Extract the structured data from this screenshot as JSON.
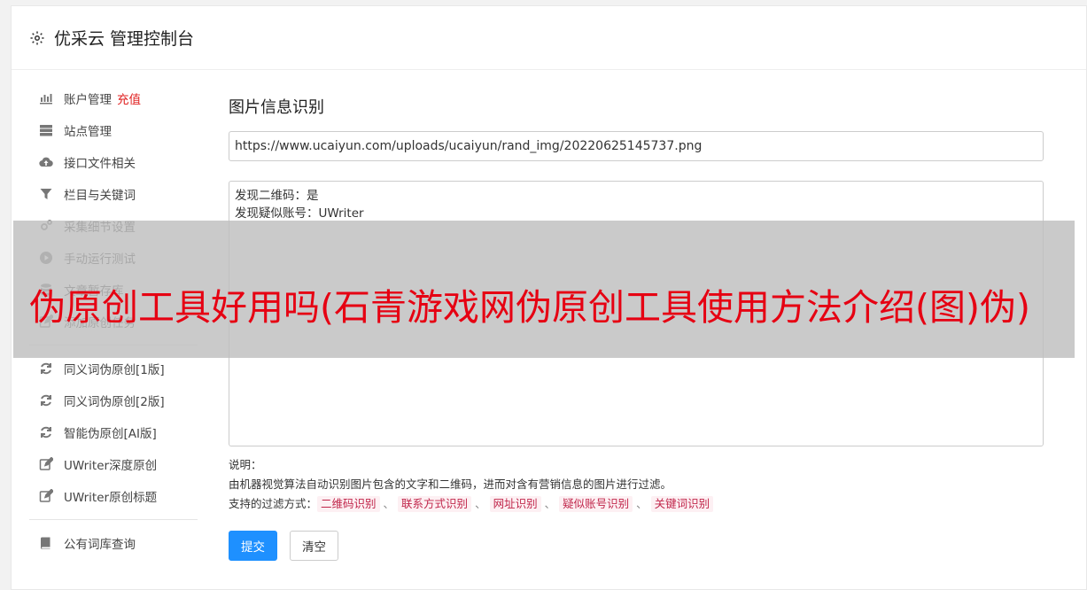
{
  "header": {
    "title": "优采云 管理控制台"
  },
  "sidebar": {
    "group1": [
      {
        "label": "账户管理",
        "icon": "bar-chart-icon",
        "badge": "充值"
      },
      {
        "label": "站点管理",
        "icon": "server-icon"
      },
      {
        "label": "接口文件相关",
        "icon": "cloud-upload-icon"
      },
      {
        "label": "栏目与关键词",
        "icon": "filter-icon"
      },
      {
        "label": "采集细节设置",
        "icon": "gears-icon"
      },
      {
        "label": "手动运行测试",
        "icon": "play-circle-icon"
      },
      {
        "label": "文章暂存库",
        "icon": "database-icon"
      },
      {
        "label": "添加原创任务",
        "icon": "edit-icon"
      }
    ],
    "group2": [
      {
        "label": "同义词伪原创[1版]",
        "icon": "refresh-icon"
      },
      {
        "label": "同义词伪原创[2版]",
        "icon": "refresh-icon"
      },
      {
        "label": "智能伪原创[AI版]",
        "icon": "refresh-icon"
      },
      {
        "label": "UWriter深度原创",
        "icon": "edit-icon"
      },
      {
        "label": "UWriter原创标题",
        "icon": "edit-icon"
      }
    ],
    "group3": [
      {
        "label": "公有词库查询",
        "icon": "book-icon"
      }
    ]
  },
  "main": {
    "title": "图片信息识别",
    "url_value": "https://www.ucaiyun.com/uploads/ucaiyun/rand_img/20220625145737.png",
    "result_lines": [
      "发现二维码：是",
      "发现疑似账号：UWriter"
    ],
    "notes_label": "说明：",
    "notes_desc": "由机器视觉算法自动识别图片包含的文字和二维码，进而对含有营销信息的图片进行过滤。",
    "filters_label": "支持的过滤方式：",
    "filters": [
      "二维码识别",
      "联系方式识别",
      "网址识别",
      "疑似账号识别",
      "关键词识别"
    ],
    "filter_sep": "、",
    "submit_label": "提交",
    "clear_label": "清空"
  },
  "overlay": {
    "text": "伪原创工具好用吗(石青游戏网伪原创工具使用方法介绍(图)伪)"
  },
  "colors": {
    "primary": "#1e90ff",
    "recharge": "#e02020",
    "overlay_text": "#e60012",
    "tag_text": "#c0254a"
  }
}
